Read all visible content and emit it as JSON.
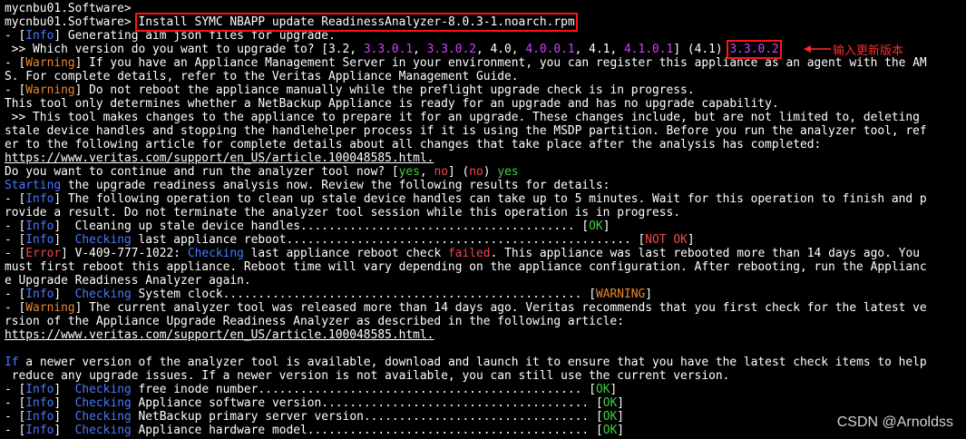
{
  "terminal": {
    "lines": [
      [
        [
          "mycnbu01.Software>",
          ""
        ]
      ],
      [
        [
          "mycnbu01.Software> ",
          ""
        ],
        [
          "Install SYMC NBAPP update ReadinessAnalyzer-8.0.3-1.noarch.rpm",
          "boxed"
        ]
      ],
      [
        [
          "- [",
          ""
        ],
        [
          "Info",
          "c-blue"
        ],
        [
          "] Generating aim json files for upgrade.",
          ""
        ]
      ],
      [
        [
          " >> Which version do you want to upgrade to? [3.2, ",
          ""
        ],
        [
          "3.3.0.1",
          "c-magenta"
        ],
        [
          ", ",
          ""
        ],
        [
          "3.3.0.2",
          "c-magenta"
        ],
        [
          ", 4.0, ",
          ""
        ],
        [
          "4.0.0.1",
          "c-magenta"
        ],
        [
          ", 4.1, ",
          ""
        ],
        [
          "4.1.0.1",
          "c-magenta"
        ],
        [
          "] (4.1) ",
          ""
        ],
        [
          "3.3.0.2",
          "c-magenta boxed"
        ]
      ],
      [
        [
          "- [",
          ""
        ],
        [
          "Warning",
          "c-orange"
        ],
        [
          "] If you have an Appliance Management Server in your environment, you can register this appliance as an agent with the AM",
          ""
        ]
      ],
      [
        [
          "S. For complete details, refer to the Veritas Appliance Management Guide.",
          ""
        ]
      ],
      [
        [
          "- [",
          ""
        ],
        [
          "Warning",
          "c-orange"
        ],
        [
          "] Do not reboot the appliance manually while the preflight upgrade check is in progress.",
          ""
        ]
      ],
      [
        [
          "This tool only determines whether a NetBackup Appliance is ready for an upgrade and has no upgrade capability.",
          ""
        ]
      ],
      [
        [
          " >> This tool makes changes to the appliance to prepare it for an upgrade. These changes include, but are not limited to, deleting",
          ""
        ]
      ],
      [
        [
          "stale device handles and stopping the handlehelper process if it is using the MSDP partition. Before you run the analyzer tool, ref",
          ""
        ]
      ],
      [
        [
          "er to the following article for complete details about all changes that take place after the analysis has completed:",
          ""
        ]
      ],
      [
        [
          "https://www.veritas.com/support/en_US/article.100048585.html.",
          "ul"
        ]
      ],
      [
        [
          "Do you want to continue and run the analyzer tool now? [",
          ""
        ],
        [
          "yes",
          "c-green"
        ],
        [
          ", ",
          ""
        ],
        [
          "no",
          "c-red"
        ],
        [
          "] (",
          ""
        ],
        [
          "no",
          "c-red"
        ],
        [
          ") ",
          ""
        ],
        [
          "yes",
          "c-green"
        ]
      ],
      [
        [
          "Starting",
          "c-blue"
        ],
        [
          " the upgrade readiness analysis now. Review the following results for details:",
          ""
        ]
      ],
      [
        [
          "- [",
          ""
        ],
        [
          "Info",
          "c-blue"
        ],
        [
          "] The following operation to clean up stale device handles can take up to 5 minutes. Wait for this operation to finish and p",
          ""
        ]
      ],
      [
        [
          "rovide a result. Do not terminate the analyzer tool session while this operation is in progress.",
          ""
        ]
      ],
      [
        [
          "- [",
          ""
        ],
        [
          "Info",
          "c-blue"
        ],
        [
          "]  Cleaning up stale device handles....................................... [",
          ""
        ],
        [
          "OK",
          "c-green"
        ],
        [
          "]",
          ""
        ]
      ],
      [
        [
          "- [",
          ""
        ],
        [
          "Info",
          "c-blue"
        ],
        [
          "]  ",
          ""
        ],
        [
          "Checking",
          "c-blue"
        ],
        [
          " last appliance reboot................................................. [",
          ""
        ],
        [
          "NOT OK",
          "c-red"
        ],
        [
          "]",
          ""
        ]
      ],
      [
        [
          "- [",
          ""
        ],
        [
          "Error",
          "c-red"
        ],
        [
          "] V-409-777-1022: ",
          ""
        ],
        [
          "Checking",
          "c-blue"
        ],
        [
          " last appliance reboot check ",
          ""
        ],
        [
          "failed",
          "c-red"
        ],
        [
          ". This appliance was last rebooted more than 14 days ago. You",
          ""
        ]
      ],
      [
        [
          "must first reboot this appliance. Reboot time will vary depending on the appliance configuration. After rebooting, run the Applianc",
          ""
        ]
      ],
      [
        [
          "e Upgrade Readiness Analyzer again.",
          ""
        ]
      ],
      [
        [
          "- [",
          ""
        ],
        [
          "Info",
          "c-blue"
        ],
        [
          "]  ",
          ""
        ],
        [
          "Checking",
          "c-blue"
        ],
        [
          " System clock................................................... [",
          ""
        ],
        [
          "WARNING",
          "c-orange"
        ],
        [
          "]",
          ""
        ]
      ],
      [
        [
          "- [",
          ""
        ],
        [
          "Warning",
          "c-orange"
        ],
        [
          "] The current analyzer tool was released more than 14 days ago. Veritas recommends that you first check for the latest ve",
          ""
        ]
      ],
      [
        [
          "rsion of the Appliance Upgrade Readiness Analyzer as described in the following article:",
          ""
        ]
      ],
      [
        [
          "https://www.veritas.com/support/en_US/article.100048585.html.",
          "ul"
        ]
      ],
      [
        [
          "",
          ""
        ]
      ],
      [
        [
          "If",
          "c-blue"
        ],
        [
          " a newer version of the analyzer tool is available, download and launch it to ensure that you have the latest check items to help",
          ""
        ]
      ],
      [
        [
          " reduce any upgrade issues. If a newer version is not available, you can still use the current version.",
          ""
        ]
      ],
      [
        [
          "- [",
          ""
        ],
        [
          "Info",
          "c-blue"
        ],
        [
          "]  ",
          ""
        ],
        [
          "Checking",
          "c-blue"
        ],
        [
          " free inode number.............................................. [",
          ""
        ],
        [
          "OK",
          "c-green"
        ],
        [
          "]",
          ""
        ]
      ],
      [
        [
          "- [",
          ""
        ],
        [
          "Info",
          "c-blue"
        ],
        [
          "]  ",
          ""
        ],
        [
          "Checking",
          "c-blue"
        ],
        [
          " Appliance software version...................................... [",
          ""
        ],
        [
          "OK",
          "c-green"
        ],
        [
          "]",
          ""
        ]
      ],
      [
        [
          "- [",
          ""
        ],
        [
          "Info",
          "c-blue"
        ],
        [
          "]  ",
          ""
        ],
        [
          "Checking",
          "c-blue"
        ],
        [
          " NetBackup primary server version................................ [",
          ""
        ],
        [
          "OK",
          "c-green"
        ],
        [
          "]",
          ""
        ]
      ],
      [
        [
          "- [",
          ""
        ],
        [
          "Info",
          "c-blue"
        ],
        [
          "]  ",
          ""
        ],
        [
          "Checking",
          "c-blue"
        ],
        [
          " Appliance hardware model........................................ [",
          ""
        ],
        [
          "OK",
          "c-green"
        ],
        [
          "]",
          ""
        ]
      ]
    ]
  },
  "annotation": {
    "text": "输入更新版本",
    "color": "#ff2a2a"
  },
  "watermark": {
    "text": "CSDN @Arnoldss"
  },
  "colors": {
    "background": "#000000",
    "text": "#ffffff",
    "info": "#4a78ff",
    "warning": "#e8862a",
    "ok": "#3fd13f",
    "error": "#f04848",
    "version": "#d040ff",
    "highlight_box": "#ff1414"
  }
}
